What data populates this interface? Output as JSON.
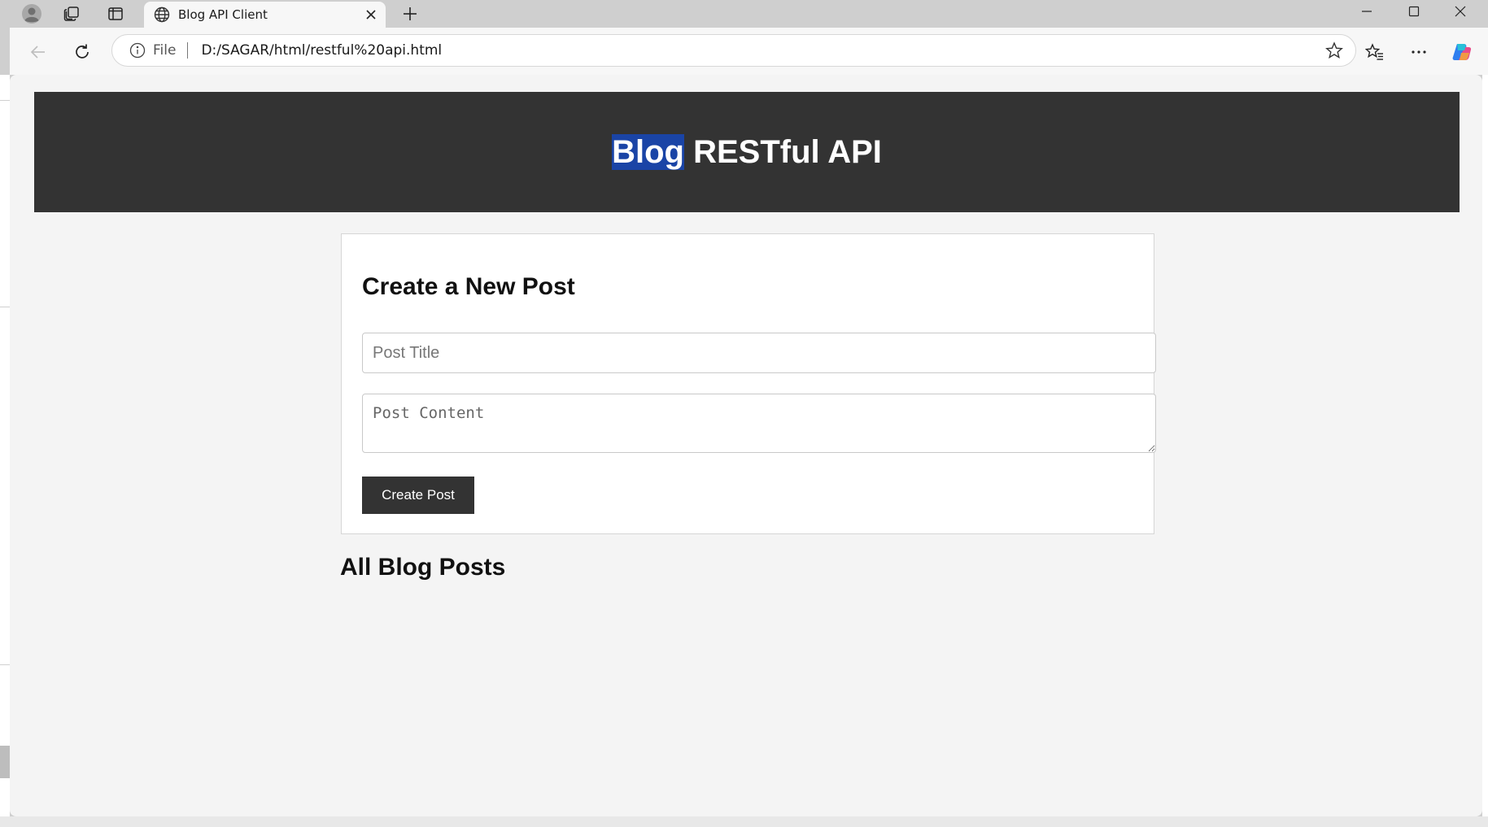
{
  "browser": {
    "tab_title": "Blog API Client",
    "address_scheme_label": "File",
    "address_url": "D:/SAGAR/html/restful%20api.html"
  },
  "page": {
    "header_title_highlight": "Blog",
    "header_title_rest": " RESTful API",
    "form": {
      "heading": "Create a New Post",
      "title_placeholder": "Post Title",
      "content_placeholder": "Post Content",
      "submit_label": "Create Post"
    },
    "posts_heading": "All Blog Posts"
  },
  "colors": {
    "header_bg": "#333333",
    "selection_highlight": "#1a44a6",
    "button_bg": "#333333",
    "page_bg": "#f4f4f4"
  },
  "icons": {
    "profile": "profile-icon",
    "workspaces": "workspaces-icon",
    "tab_actions": "vertical-tabs-icon",
    "favicon": "globe-icon",
    "close": "close-icon",
    "new_tab": "plus-icon",
    "back": "back-arrow-icon",
    "refresh": "refresh-icon",
    "info": "info-icon",
    "favorite": "star-icon",
    "favorites_list": "favorites-icon",
    "more": "more-icon",
    "copilot": "copilot-icon"
  }
}
